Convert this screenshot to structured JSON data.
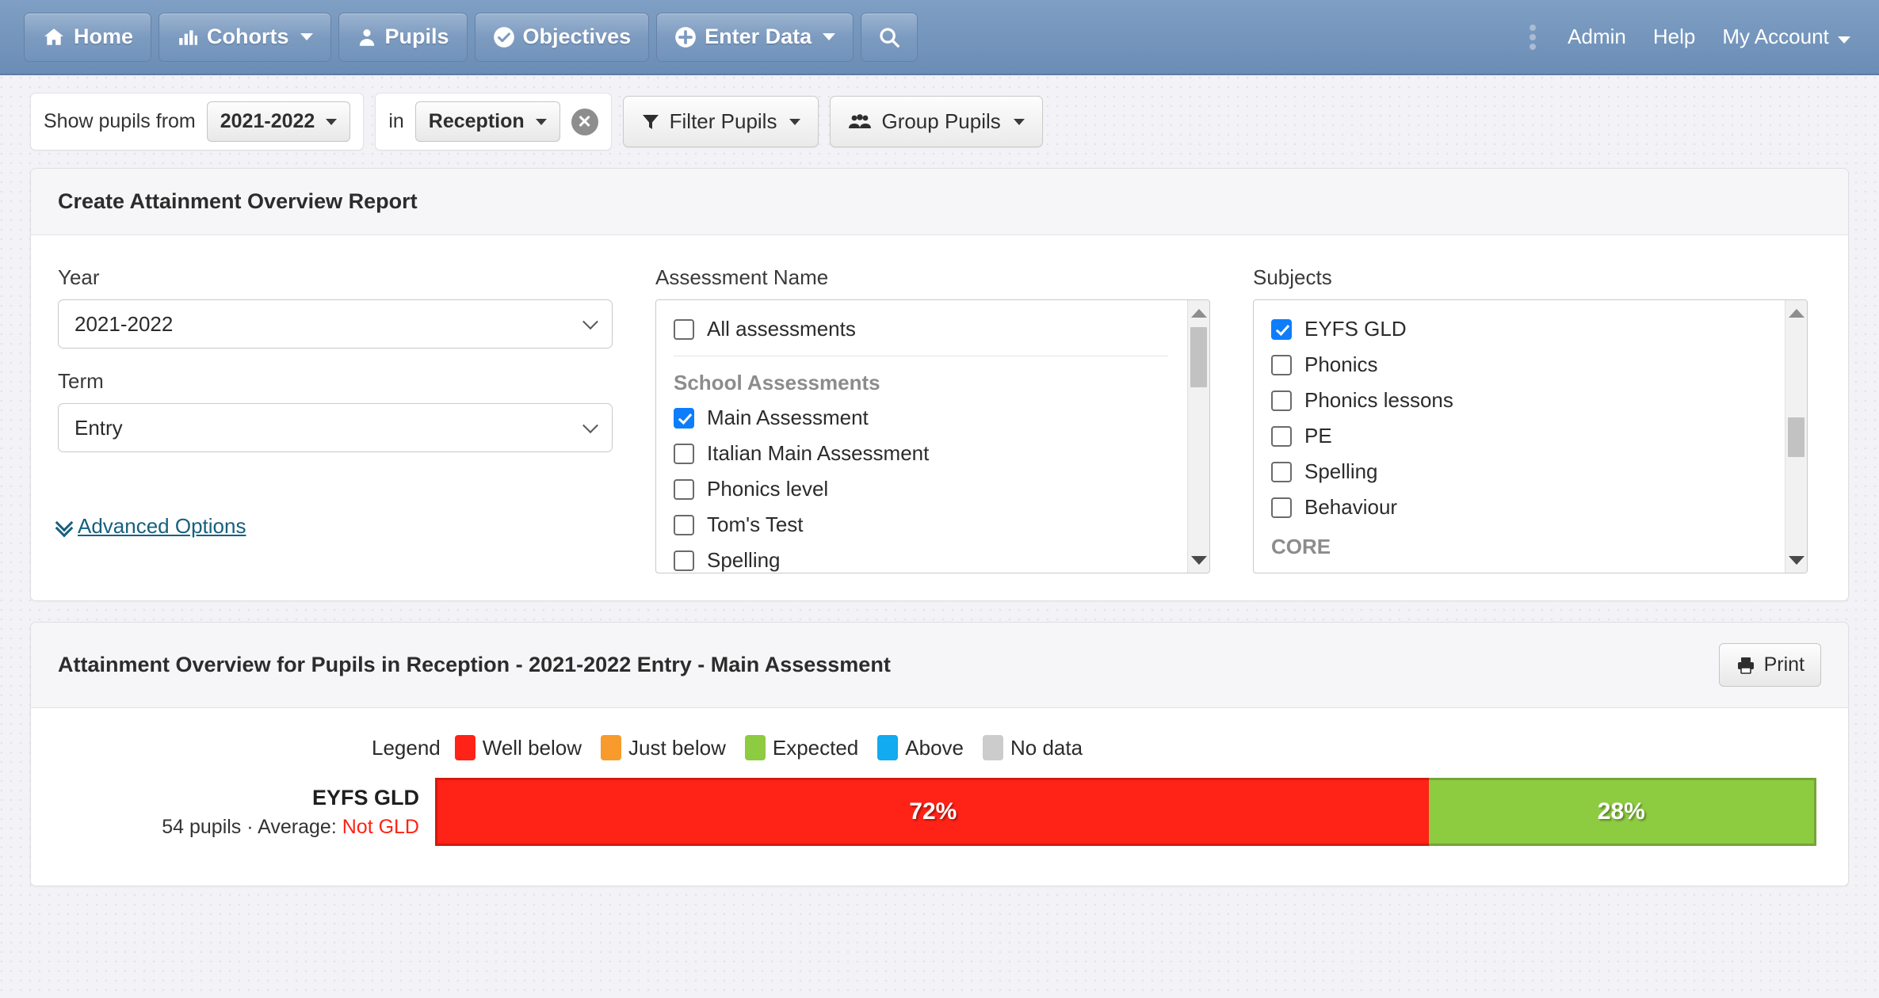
{
  "navbar": {
    "items": [
      {
        "label": "Home",
        "icon": "home-icon",
        "caret": false
      },
      {
        "label": "Cohorts",
        "icon": "chart-bar-icon",
        "caret": true
      },
      {
        "label": "Pupils",
        "icon": "user-icon",
        "caret": false
      },
      {
        "label": "Objectives",
        "icon": "check-circle-icon",
        "caret": false
      },
      {
        "label": "Enter Data",
        "icon": "plus-circle-icon",
        "caret": true
      }
    ],
    "search_icon": "search-icon",
    "menu_icon": "vertical-dots-icon",
    "right_links": [
      {
        "label": "Admin",
        "caret": false
      },
      {
        "label": "Help",
        "caret": false
      },
      {
        "label": "My Account",
        "caret": true
      }
    ]
  },
  "filterbar": {
    "show_pupils_from_label": "Show pupils from",
    "year_value": "2021-2022",
    "in_label": "in",
    "cohort_value": "Reception",
    "clear_icon": "clear-circle-icon",
    "filter_pupils_label": "Filter Pupils",
    "filter_icon": "funnel-icon",
    "group_pupils_label": "Group Pupils",
    "group_icon": "users-icon"
  },
  "create_panel": {
    "title": "Create Attainment Overview Report",
    "year_label": "Year",
    "year_value": "2021-2022",
    "term_label": "Term",
    "term_value": "Entry",
    "advanced_options_label": "Advanced Options",
    "advanced_icon": "double-chevron-down-icon",
    "assessment_label": "Assessment Name",
    "assessment_items": [
      {
        "label": "All assessments",
        "checked": false,
        "type": "item"
      },
      {
        "label": "",
        "type": "separator"
      },
      {
        "label": "School Assessments",
        "type": "group"
      },
      {
        "label": "Main Assessment",
        "checked": true,
        "type": "item"
      },
      {
        "label": "Italian Main Assessment",
        "checked": false,
        "type": "item"
      },
      {
        "label": "Phonics level",
        "checked": false,
        "type": "item"
      },
      {
        "label": "Tom's Test",
        "checked": false,
        "type": "item"
      },
      {
        "label": "Spelling",
        "checked": false,
        "type": "item"
      }
    ],
    "subjects_label": "Subjects",
    "subject_items": [
      {
        "label": "EYFS GLD",
        "checked": true,
        "type": "item"
      },
      {
        "label": "Phonics",
        "checked": false,
        "type": "item"
      },
      {
        "label": "Phonics lessons",
        "checked": false,
        "type": "item"
      },
      {
        "label": "PE",
        "checked": false,
        "type": "item"
      },
      {
        "label": "Spelling",
        "checked": false,
        "type": "item"
      },
      {
        "label": "Behaviour",
        "checked": false,
        "type": "item"
      },
      {
        "label": "CORE",
        "type": "group"
      }
    ]
  },
  "report_panel": {
    "title": "Attainment Overview for Pupils in Reception - 2021-2022 Entry - Main Assessment",
    "print_label": "Print",
    "print_icon": "printer-icon"
  },
  "chart_data": {
    "type": "bar",
    "orientation": "horizontal",
    "stacked": true,
    "title": "Attainment Overview for Pupils in Reception - 2021-2022 Entry - Main Assessment",
    "legend_title": "Legend",
    "legend_position": "top",
    "legend": [
      {
        "name": "Well below",
        "color": "#ff2216"
      },
      {
        "name": "Just below",
        "color": "#f89a2c"
      },
      {
        "name": "Expected",
        "color": "#8dcb41"
      },
      {
        "name": "Above",
        "color": "#12aaf0"
      },
      {
        "name": "No data",
        "color": "#cccccc"
      }
    ],
    "categories": [
      "EYFS GLD"
    ],
    "rows": [
      {
        "category": "EYFS GLD",
        "pupils_text": "54 pupils",
        "separator": "·",
        "average_label": "Average:",
        "average_value": "Not GLD",
        "average_color": "#ff2216",
        "segments": [
          {
            "name": "Well below",
            "value": 72,
            "label": "72%",
            "color": "#ff2216"
          },
          {
            "name": "Expected",
            "value": 28,
            "label": "28%",
            "color": "#8dcb41"
          }
        ]
      }
    ],
    "xlabel": "",
    "ylabel": "",
    "xlim": [
      0,
      100
    ],
    "grid": false
  }
}
